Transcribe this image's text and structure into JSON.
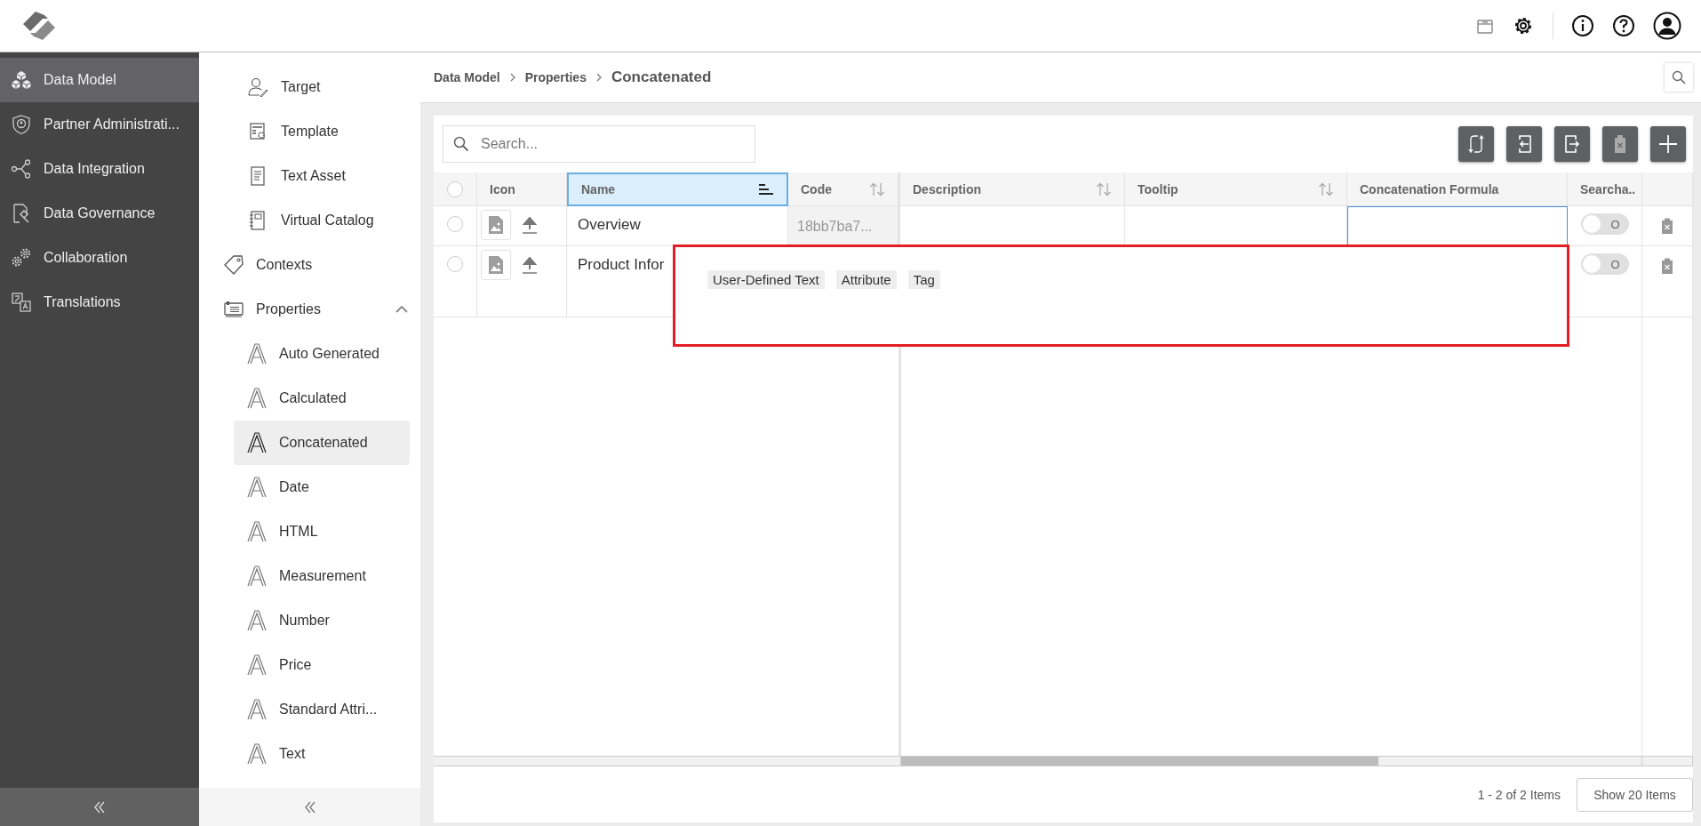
{
  "nav": {
    "items": [
      {
        "label": "Data Model",
        "selected": true
      },
      {
        "label": "Partner Administrati...",
        "selected": false
      },
      {
        "label": "Data Integration",
        "selected": false
      },
      {
        "label": "Data Governance",
        "selected": false
      },
      {
        "label": "Collaboration",
        "selected": false
      },
      {
        "label": "Translations",
        "selected": false
      }
    ]
  },
  "subnav": {
    "items": [
      {
        "children": [
          {
            "label": "Target",
            "selected": false
          },
          {
            "label": "Template",
            "selected": false
          },
          {
            "label": "Text Asset",
            "selected": false
          },
          {
            "label": "Virtual Catalog",
            "selected": false
          }
        ]
      },
      {
        "label": "Contexts",
        "selected": false
      },
      {
        "label": "Properties",
        "selected": false,
        "expanded": true,
        "children": [
          {
            "label": "Auto Generated",
            "selected": false
          },
          {
            "label": "Calculated",
            "selected": false
          },
          {
            "label": "Concatenated",
            "selected": true
          },
          {
            "label": "Date",
            "selected": false
          },
          {
            "label": "HTML",
            "selected": false
          },
          {
            "label": "Measurement",
            "selected": false
          },
          {
            "label": "Number",
            "selected": false
          },
          {
            "label": "Price",
            "selected": false
          },
          {
            "label": "Standard Attri...",
            "selected": false
          },
          {
            "label": "Text",
            "selected": false
          }
        ]
      }
    ]
  },
  "breadcrumb": {
    "links": [
      "Data Model",
      "Properties"
    ],
    "current": "Concatenated"
  },
  "search": {
    "placeholder": "Search..."
  },
  "table": {
    "all_selected": false,
    "columns": [
      {
        "label": "Icon",
        "sortable": false,
        "sorted": false,
        "selected": false
      },
      {
        "label": "Name",
        "sorted": true,
        "selected": true
      },
      {
        "label": "Code",
        "sortable": true,
        "sorted": false,
        "selected": false
      },
      {
        "label": "Description",
        "sortable": true,
        "sorted": false,
        "selected": false
      },
      {
        "label": "Tooltip",
        "sortable": true,
        "sorted": false,
        "selected": false
      },
      {
        "label": "Concatenation Formula",
        "sortable": false,
        "sorted": false,
        "selected": false
      },
      {
        "label": "Searcha..",
        "sortable": false,
        "sorted": false,
        "selected": false
      }
    ],
    "rows": [
      {
        "selected": false,
        "name": "Overview",
        "code": "18bb7ba7...",
        "formula_focused": true,
        "searchable": {
          "on": false,
          "label": "O"
        }
      },
      {
        "selected": false,
        "name": "Product Infor",
        "searchable": {
          "on": false,
          "label": "O"
        }
      }
    ]
  },
  "formula_popup": {
    "chips": [
      "User-Defined Text",
      "Attribute",
      "Tag"
    ]
  },
  "footer": {
    "count": "1 - 2 of 2 Items",
    "page_size_button": "Show 20 Items"
  }
}
